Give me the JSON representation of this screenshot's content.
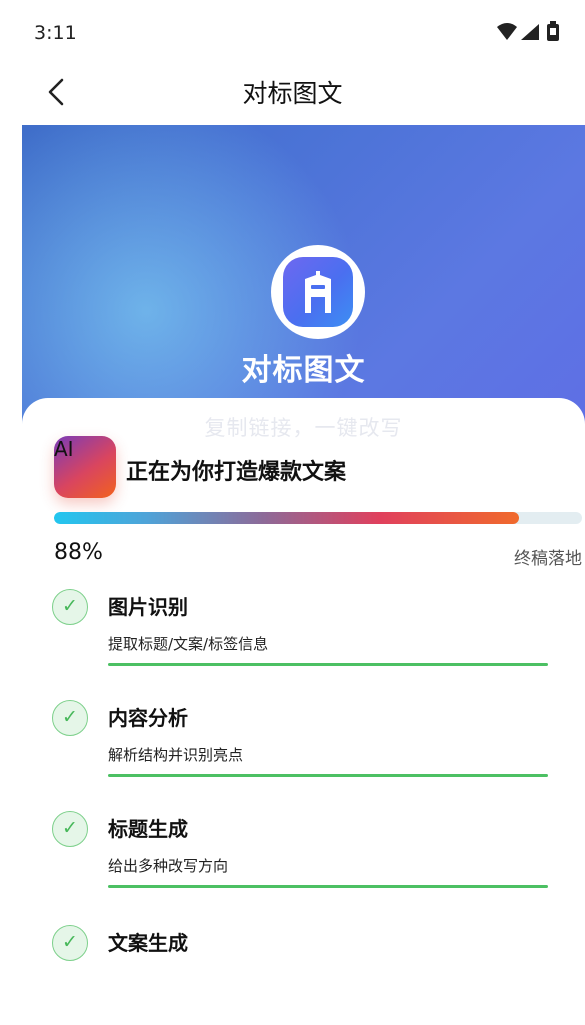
{
  "status_bar": {
    "time": "3:11",
    "icons": [
      "wifi-icon",
      "signal-icon",
      "battery-icon"
    ]
  },
  "nav": {
    "title": "对标图文",
    "back_icon": "chevron-left-icon"
  },
  "hero": {
    "title": "对标图文",
    "logo_icon": "building-logo-icon"
  },
  "card": {
    "subtitle": "复制链接，一键改写",
    "ai_badge": "AI",
    "heading": "正在为你打造爆款文案",
    "progress": {
      "percent_text": "88%",
      "value": 0.88,
      "stage": "终稿落地"
    },
    "steps": [
      {
        "title": "图片识别",
        "desc": "提取标题/文案/标签信息",
        "done": true
      },
      {
        "title": "内容分析",
        "desc": "解析结构并识别亮点",
        "done": true
      },
      {
        "title": "标题生成",
        "desc": "给出多种改写方向",
        "done": true
      },
      {
        "title": "文案生成",
        "desc": "",
        "done": true
      }
    ],
    "check_glyph": "✓"
  },
  "colors": {
    "accent_green": "#4cc063",
    "hero_blue": "#4b73d6"
  }
}
